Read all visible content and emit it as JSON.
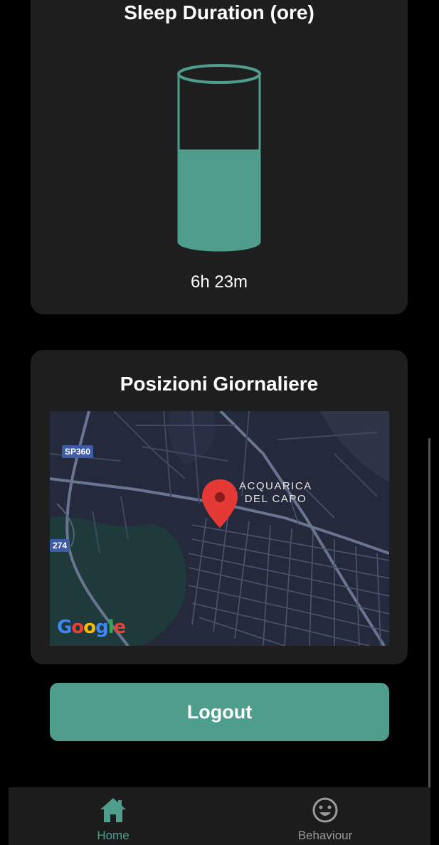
{
  "sleep_card": {
    "title": "Sleep Duration (ore)",
    "value": "6h 23m",
    "fill_fraction": 0.55
  },
  "positions_card": {
    "title": "Posizioni Giornaliere",
    "map": {
      "place_label_line1": "ACQUARICA",
      "place_label_line2": "DEL CAPO",
      "road_shields": [
        "SP360",
        "274"
      ],
      "attribution": "Google"
    }
  },
  "logout_label": "Logout",
  "bottom_nav": {
    "items": [
      {
        "label": "Home",
        "icon": "home-icon",
        "active": true
      },
      {
        "label": "Behaviour",
        "icon": "smiley-icon",
        "active": false
      }
    ]
  },
  "colors": {
    "accent": "#4f9d8c",
    "card_bg": "#1e1e1e",
    "background": "#000000",
    "map_bg": "#242a3b",
    "marker": "#e53935",
    "inactive_text": "#9a9a9a"
  }
}
